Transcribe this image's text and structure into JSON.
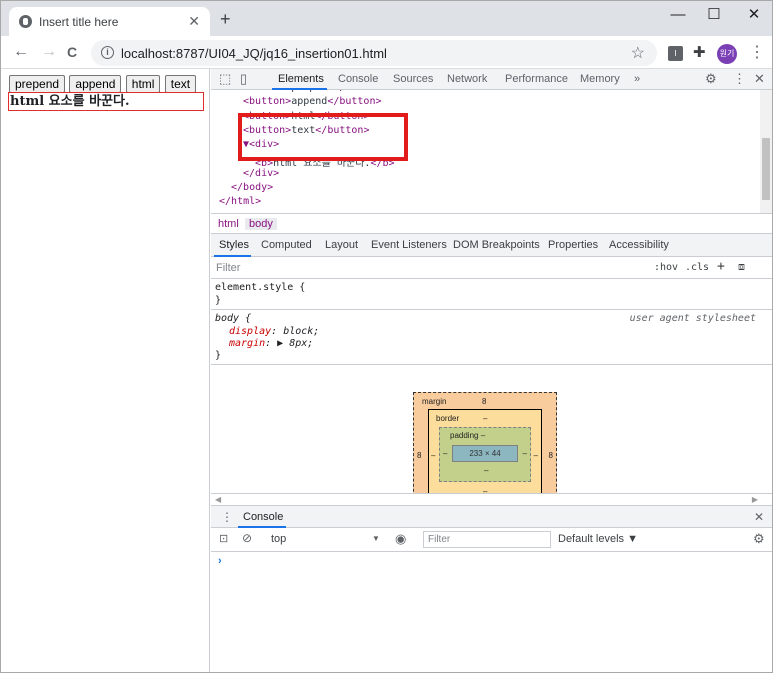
{
  "browser": {
    "tab_title": "Insert title here",
    "tab_close": "✕",
    "new_tab": "+",
    "win_min": "—",
    "win_max": "☐",
    "win_close": "✕",
    "url": "localhost:8787/UI04_JQ/jq16_insertion01.html",
    "back": "←",
    "forward": "→",
    "reload": "C",
    "info": "i",
    "star": "☆",
    "ext1": "I",
    "ext2": "✚",
    "avatar_text": "원기",
    "menu": "⋮"
  },
  "page": {
    "buttons": [
      "prepend",
      "append",
      "html",
      "text"
    ],
    "div_text": "html 요소를 바꾼다."
  },
  "devtools": {
    "tabs": [
      "Elements",
      "Console",
      "Sources",
      "Network",
      "Performance",
      "Memory",
      "»"
    ],
    "elements_lines": [
      {
        "indent": 0,
        "open": "<",
        "tag": "button",
        "close": ">",
        "text": "prepend",
        "end": "</button>"
      },
      {
        "indent": 0,
        "open": "<",
        "tag": "button",
        "close": ">",
        "text": "append",
        "end": "</button>"
      },
      {
        "indent": 0,
        "open": "<",
        "tag": "button",
        "close": ">",
        "text": "html",
        "end": "</button>"
      },
      {
        "indent": 0,
        "open": "<",
        "tag": "button",
        "close": ">",
        "text": "text",
        "end": "</button>"
      },
      {
        "indent": 0,
        "open": "▼<",
        "tag": "div",
        "close": ">",
        "text": "",
        "end": ""
      },
      {
        "indent": 1,
        "open": "<",
        "tag": "b",
        "close": ">",
        "text": "html 요소를 바꾼다.",
        "end": "</b>"
      },
      {
        "indent": 0,
        "open": "</",
        "tag": "div",
        "close": ">",
        "text": "",
        "end": ""
      },
      {
        "indent": -1,
        "open": "</",
        "tag": "body",
        "close": ">",
        "text": "",
        "end": ""
      },
      {
        "indent": -2,
        "open": "</",
        "tag": "html",
        "close": ">",
        "text": "",
        "end": ""
      }
    ],
    "breadcrumbs": [
      "html",
      "body"
    ],
    "styles_tabs": [
      "Styles",
      "Computed",
      "Layout",
      "Event Listeners",
      "DOM Breakpoints",
      "Properties",
      "Accessibility"
    ],
    "filter_placeholder": "Filter",
    "hov": ":hov",
    "cls": ".cls",
    "plus": "+",
    "rule1_selector": "element.style {",
    "rule1_close": "}",
    "rule2_selector": "body {",
    "rule2_source": "user agent stylesheet",
    "rule2_props": [
      {
        "name": "display",
        "value": "block;"
      },
      {
        "name": "margin",
        "value": "▶ 8px;"
      }
    ],
    "rule2_close": "}",
    "box": {
      "margin_label": "margin",
      "margin_value": "8",
      "border_label": "border",
      "border_value": "–",
      "padding_label": "padding –",
      "content": "233 × 44",
      "side_left": "8",
      "side_right": "8",
      "dash": "–"
    },
    "console": {
      "title": "Console",
      "context": "top",
      "filter_placeholder": "Filter",
      "levels": "Default levels ▼",
      "prompt": "›"
    }
  }
}
